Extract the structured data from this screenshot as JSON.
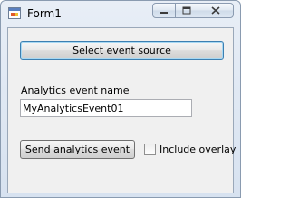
{
  "window": {
    "title": "Form1",
    "app_icon": "windows-form-icon"
  },
  "caption_buttons": {
    "minimize": "minimize-icon",
    "maximize": "maximize-icon",
    "close": "close-icon"
  },
  "form": {
    "select_source_label": "Select event source",
    "event_name_label": "Analytics event name",
    "event_name_value": "MyAnalyticsEvent01",
    "send_label": "Send analytics event",
    "include_overlay_label": "Include overlay",
    "include_overlay_checked": false
  }
}
